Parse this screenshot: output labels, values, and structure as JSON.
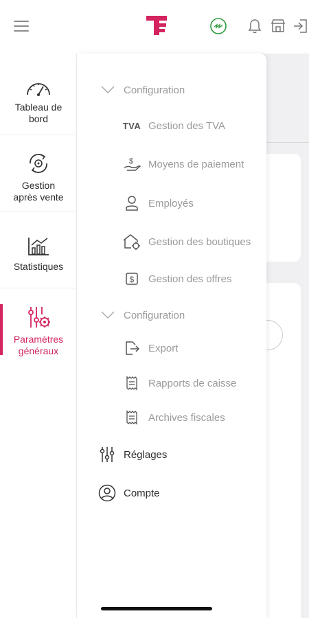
{
  "rail": {
    "items": [
      {
        "label_line1": "Tableau de",
        "label_line2": "bord"
      },
      {
        "label_line1": "Gestion",
        "label_line2": "après vente"
      },
      {
        "label_line1": "Statistiques",
        "label_line2": ""
      },
      {
        "label_line1": "Paramètres",
        "label_line2": "généraux"
      }
    ],
    "active_index": 3
  },
  "drawer": {
    "section1": {
      "title": "Configuration",
      "items": [
        {
          "icon": "tva-icon",
          "icon_text": "TVA",
          "label": "Gestion des TVA"
        },
        {
          "icon": "hand-money-icon",
          "label": "Moyens de paiement"
        },
        {
          "icon": "user-icon",
          "label": "Employés"
        },
        {
          "icon": "shop-gear-icon",
          "label": "Gestion des boutiques"
        },
        {
          "icon": "dollar-tag-icon",
          "label": "Gestion des offres"
        }
      ]
    },
    "section2": {
      "title": "Configuration",
      "items": [
        {
          "icon": "export-icon",
          "label": "Export"
        },
        {
          "icon": "receipt-icon",
          "label": "Rapports de caisse"
        },
        {
          "icon": "receipt-icon",
          "label": "Archives fiscales"
        }
      ]
    },
    "bottom": [
      {
        "icon": "sliders-icon",
        "label": "Réglages"
      },
      {
        "icon": "account-icon",
        "label": "Compte"
      }
    ]
  },
  "colors": {
    "accent": "#d3245f",
    "online": "#2e9a3a",
    "muted": "#9a9a9a",
    "text": "#2b2b2b"
  }
}
